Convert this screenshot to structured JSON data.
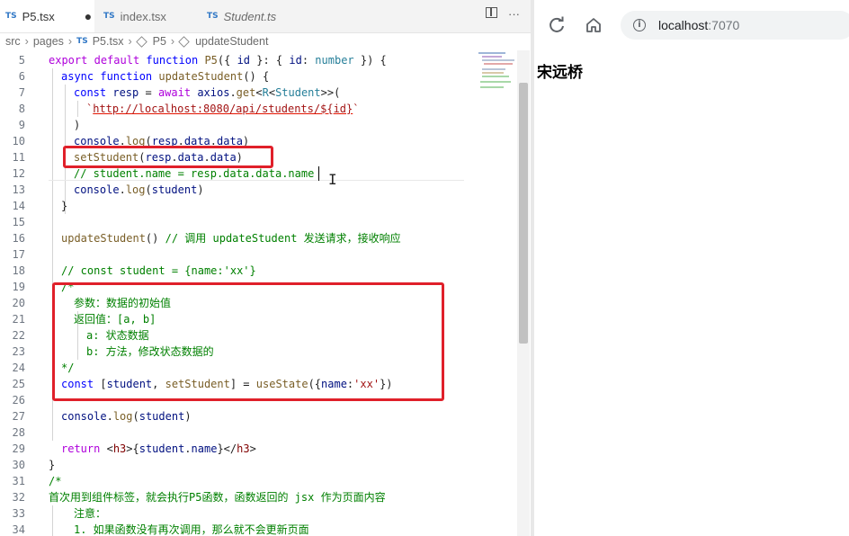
{
  "editor": {
    "tabs": [
      {
        "badge": "TS",
        "label": "P5.tsx",
        "modified": "●"
      },
      {
        "badge": "TS",
        "label": "index.tsx"
      },
      {
        "badge": "TS",
        "label": "Student.ts"
      }
    ],
    "actions": {
      "split_icon": "split-editor-icon",
      "more": "···"
    },
    "breadcrumb": [
      "src",
      "pages",
      "TS",
      "P5.tsx",
      "P5",
      "updateStudent"
    ],
    "line_numbers": [
      "5",
      "6",
      "7",
      "8",
      "9",
      "10",
      "11",
      "12",
      "13",
      "14",
      "15",
      "16",
      "17",
      "18",
      "19",
      "20",
      "21",
      "22",
      "23",
      "24",
      "25",
      "26",
      "27",
      "28",
      "29",
      "30",
      "31",
      "32",
      "33",
      "34"
    ],
    "code": {
      "l5": {
        "a": "export",
        "b": "default",
        "c": "function",
        "d": "P5",
        "e": "({ ",
        "f": "id",
        "g": " }: { ",
        "h": "id",
        "i": ": ",
        "j": "number",
        "k": " }) {"
      },
      "l6": {
        "a": "async",
        "b": "function",
        "c": "updateStudent",
        "d": "() {"
      },
      "l7": {
        "a": "const",
        "b": "resp",
        "c": " = ",
        "d": "await",
        "e": "axios",
        "f": ".",
        "g": "get",
        "h": "<",
        "i": "R",
        "j": "<",
        "k": "Student",
        "l": ">>("
      },
      "l8": {
        "a": "`",
        "b": "http://localhost:8080/api/students/",
        "c": "${",
        "d": "id",
        "e": "}",
        "f": "`"
      },
      "l9": {
        "a": ")"
      },
      "l10": {
        "a": "console",
        "b": ".",
        "c": "log",
        "d": "(",
        "e": "resp",
        "f": ".",
        "g": "data",
        "h": ".",
        "i": "data",
        "j": ")"
      },
      "l11": {
        "a": "setStudent",
        "b": "(",
        "c": "resp",
        "d": ".",
        "e": "data",
        "f": ".",
        "g": "data",
        "h": ")"
      },
      "l12": {
        "a": "// student.name = resp.data.data.name"
      },
      "l13": {
        "a": "console",
        "b": ".",
        "c": "log",
        "d": "(",
        "e": "student",
        "f": ")"
      },
      "l14": {
        "a": "}"
      },
      "l16": {
        "a": "updateStudent",
        "b": "() ",
        "c": "// 调用 updateStudent 发送请求，接收响应"
      },
      "l18": {
        "a": "// const student = {name:'xx'}"
      },
      "l19": {
        "a": "/*"
      },
      "l20": {
        "a": "参数：数据的初始值"
      },
      "l21": {
        "a": "返回值：[a, b]"
      },
      "l22": {
        "a": "a: 状态数据"
      },
      "l23": {
        "a": "b: 方法，修改状态数据的"
      },
      "l24": {
        "a": "*/"
      },
      "l25": {
        "a": "const",
        "b": " [",
        "c": "student",
        "d": ", ",
        "e": "setStudent",
        "f": "] = ",
        "g": "useState",
        "h": "({",
        "i": "name",
        "j": ":",
        "k": "'xx'",
        "l": "})"
      },
      "l27": {
        "a": "console",
        "b": ".",
        "c": "log",
        "d": "(",
        "e": "student",
        "f": ")"
      },
      "l29": {
        "a": "return",
        "b": " <",
        "c": "h3",
        "d": ">{",
        "e": "student",
        "f": ".",
        "g": "name",
        "h": "}</",
        "i": "h3",
        "j": ">"
      },
      "l30": {
        "a": "}"
      },
      "l31": {
        "a": "/*"
      },
      "l32": {
        "a": "首次用到组件标签，就会执行P5函数，函数返回的 jsx 作为页面内容"
      },
      "l33": {
        "a": "注意："
      },
      "l34": {
        "a": "1. 如果函数没有再次调用，那么就不会更新页面"
      }
    },
    "colors": {
      "highlight": "#e0202a",
      "keyword": "#0000ff",
      "control": "#af00db",
      "function": "#795e26",
      "type": "#267f99",
      "string": "#a31515",
      "comment": "#008000"
    }
  },
  "browser": {
    "reload_icon": "reload-icon",
    "home_icon": "home-icon",
    "info_icon": "i",
    "host": "localhost",
    "port": ":7070",
    "heading": "宋远桥"
  }
}
